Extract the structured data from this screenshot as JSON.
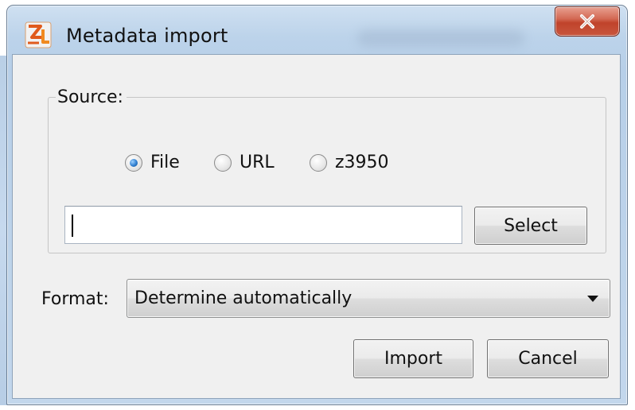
{
  "window": {
    "title": "Metadata import",
    "icon": "jabref-app-icon",
    "close_icon": "close-x-icon"
  },
  "source": {
    "label": "Source:",
    "options": [
      {
        "label": "File",
        "selected": true
      },
      {
        "label": "URL",
        "selected": false
      },
      {
        "label": "z3950",
        "selected": false
      }
    ],
    "input_value": "",
    "select_label": "Select"
  },
  "format": {
    "label": "Format:",
    "selected": "Determine automatically",
    "arrow_icon": "dropdown-arrow-icon"
  },
  "actions": {
    "import_label": "Import",
    "cancel_label": "Cancel"
  },
  "colors": {
    "titlebar": "#bcd3ea",
    "dialog_bg": "#f0f0f0",
    "close_button": "#c0432b",
    "radio_selected": "#2f7fd0"
  }
}
